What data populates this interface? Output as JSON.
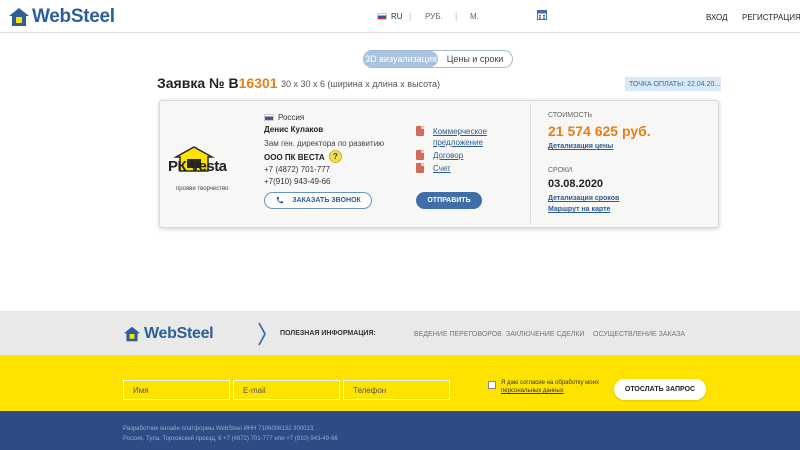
{
  "header": {
    "logo_text": "WebSteel",
    "lang": "RU",
    "currency": "РУБ.",
    "unit": "М.",
    "login": "ВХОД",
    "register": "РЕГИСТРАЦИЯ"
  },
  "toggle": {
    "options": [
      "3D визуализация",
      "Цены и сроки"
    ],
    "active_index": 0
  },
  "order": {
    "prefix": "Заявка № В",
    "number": "16301",
    "dimensions": "30 х 30 х 6 (ширина х длина х высота)",
    "payment_point": "ТОЧКА ОПЛАТЫ: 22.04.20..."
  },
  "vendor": {
    "logo_text": "РК Vesta",
    "slogan": "прояви творчество",
    "country": "Россия",
    "person": "Денис Кулаков",
    "position": "Зам ген. директора по развитию",
    "company": "ООО ПК ВЕСТА",
    "phone1": "+7 (4872) 701-777",
    "phone2": "+7(910) 943-49-66",
    "call_button": "ЗАКАЗАТЬ ЗВОНОК"
  },
  "documents": [
    {
      "label": "Коммерческое предложение"
    },
    {
      "label": "Договор"
    },
    {
      "label": "Счет"
    }
  ],
  "send_button": "ОТПРАВИТЬ",
  "pricing": {
    "cost_label": "СТОИМОСТЬ",
    "cost_value": "21 574 625 руб.",
    "cost_link": "Детализация цены",
    "terms_label": "СРОКИ",
    "terms_value": "03.08.2020",
    "terms_link": "Детализация сроков",
    "route_link": "Маршрут на карте"
  },
  "footer": {
    "logo_text": "WebSteel",
    "useful_label": "ПОЛЕЗНАЯ ИНФОРМАЦИЯ:",
    "links": [
      "ВЕДЕНИЕ ПЕРЕГОВОРОВ",
      "ЗАКЛЮЧЕНИЕ СДЕЛКИ",
      "ОСУЩЕСТВЛЕНИЕ ЗАКАЗА"
    ],
    "form": {
      "name_placeholder": "Имя",
      "email_placeholder": "E-mail",
      "phone_placeholder": "Телефон",
      "consent_text": "Я даю согласие на обработку моих",
      "consent_link": "персональных данных",
      "submit": "ОТОСЛАТЬ ЗАПРОС"
    },
    "developer_line1": "Разработчик онлайн платформы WebSteel ИНН 7106006132 300013,",
    "developer_line2": "Россия, Тула, Торховский проезд, 6 +7 (4872) 701-777 или +7 (910) 943-49-66"
  },
  "colors": {
    "brand_blue": "#2d5f97",
    "accent_orange": "#e57f16",
    "footer_yellow": "#ffe300",
    "footer_navy": "#2e4b85"
  }
}
